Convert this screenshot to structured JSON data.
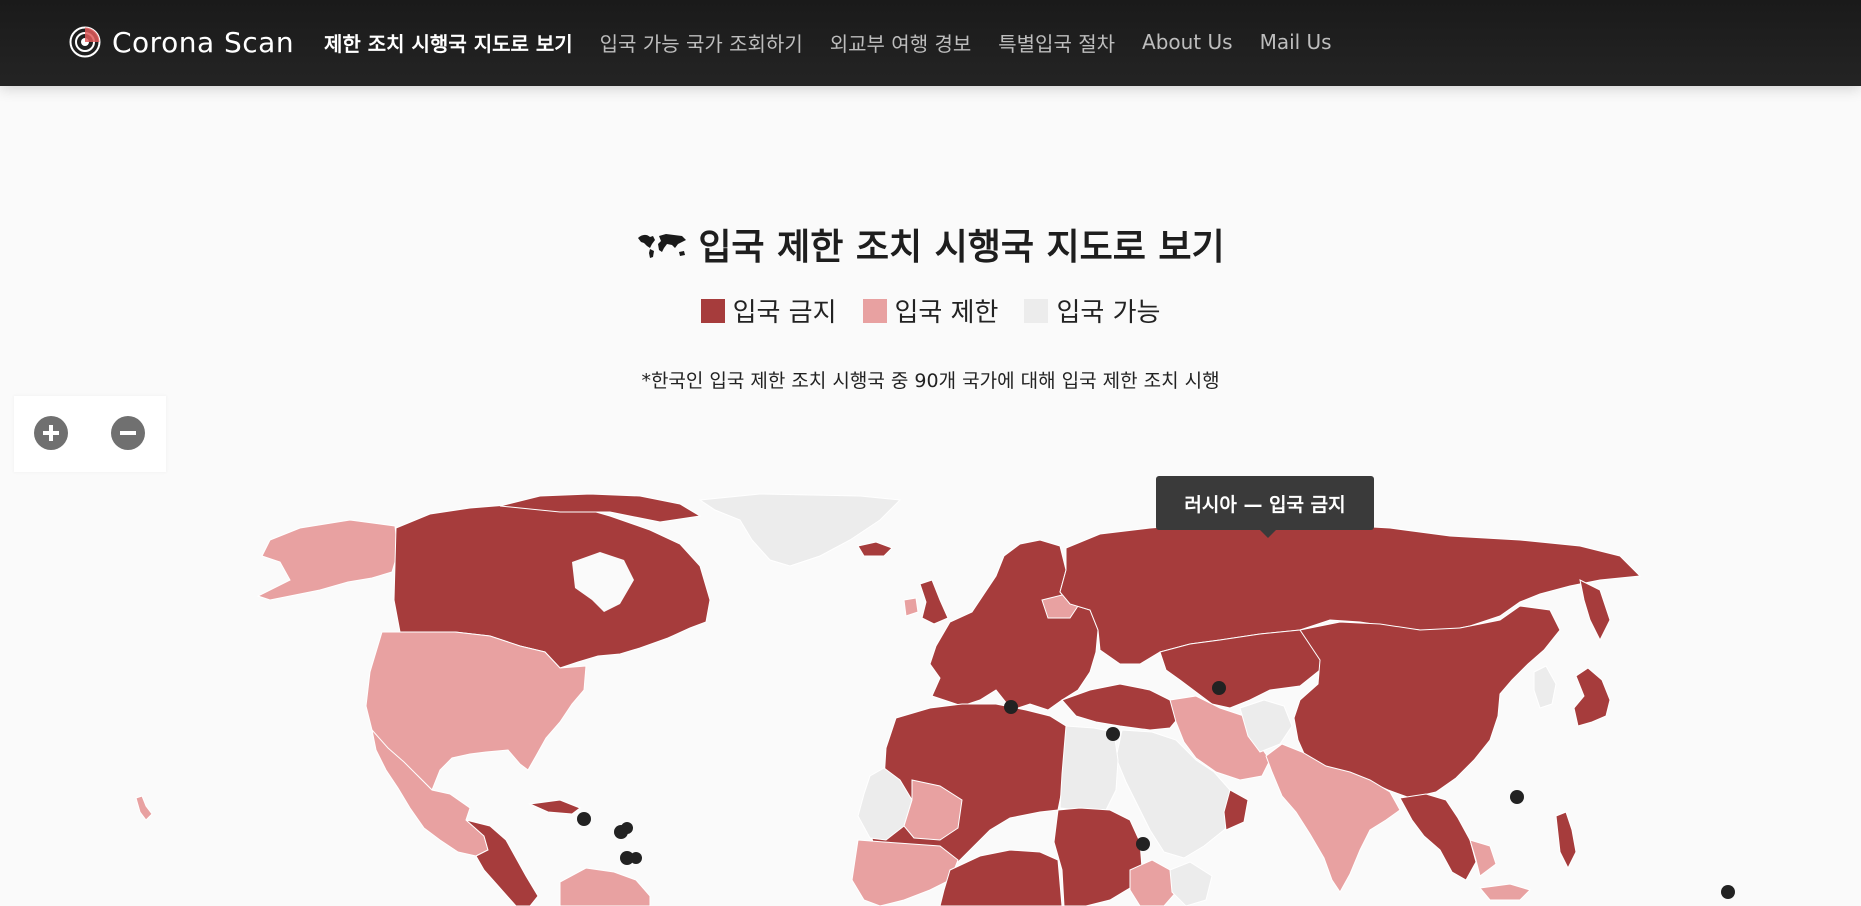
{
  "brand": {
    "name": "Corona Scan",
    "logo_icon": "radar-logo-icon"
  },
  "nav": {
    "items": [
      {
        "label": "제한 조치 시행국 지도로 보기",
        "active": true
      },
      {
        "label": "입국 가능 국가 조회하기",
        "active": false
      },
      {
        "label": "외교부 여행 경보",
        "active": false
      },
      {
        "label": "특별입국 절차",
        "active": false
      },
      {
        "label": "About Us",
        "active": false
      },
      {
        "label": "Mail Us",
        "active": false
      }
    ]
  },
  "header": {
    "title_icon": "world-map-icon",
    "title": "입국 제한 조치 시행국 지도로 보기",
    "legend": [
      {
        "label": "입국 금지",
        "color": "#a63c3c"
      },
      {
        "label": "입국 제한",
        "color": "#e8a1a1"
      },
      {
        "label": "입국 가능",
        "color": "#ececec"
      }
    ],
    "note": "*한국인 입국 제한 조치 시행국 중 90개 국가에 대해 입국 제한 조치 시행"
  },
  "zoom": {
    "in_icon": "zoom-in-icon",
    "out_icon": "zoom-out-icon"
  },
  "tooltip": {
    "text": "러시아 — 입국 금지"
  },
  "map": {
    "colors": {
      "ban": "#a63c3c",
      "restrict": "#e8a1a1",
      "allow": "#ececec",
      "marker": "#222222"
    },
    "regions": {
      "alaska": "restrict",
      "canada": "ban",
      "greenland": "allow",
      "usa": "restrict",
      "mexico": "restrict",
      "central_america": "ban",
      "south_america_north": "restrict",
      "russia": "ban",
      "europe": "ban",
      "uk": "ban",
      "iceland": "ban",
      "north_africa": "ban",
      "west_africa": "restrict",
      "egypt": "allow",
      "sudan": "ban",
      "arabia": "allow",
      "turkey_caucasus": "ban",
      "iran": "restrict",
      "central_asia": "ban",
      "afghanistan": "allow",
      "china": "ban",
      "mongolia": "ban",
      "india": "restrict",
      "southeast_asia": "ban",
      "japan": "ban",
      "korea": "allow",
      "philippines": "ban",
      "hawaii": "restrict"
    }
  }
}
